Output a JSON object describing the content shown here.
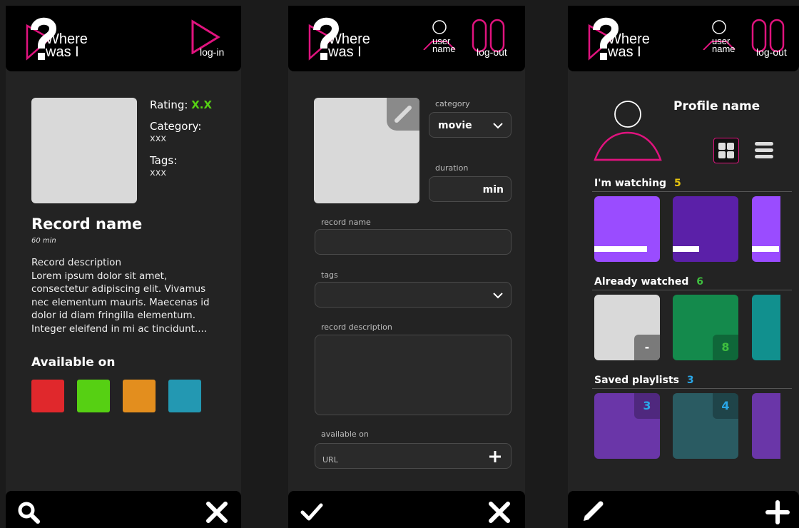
{
  "app": {
    "logo_line1": "Where",
    "logo_line2": "was I"
  },
  "screen1": {
    "header": {
      "login_label": "log-in"
    },
    "rating_label": "Rating:",
    "rating_value": "X.X",
    "category_label": "Category:",
    "category_value": "xxx",
    "tags_label": "Tags:",
    "tags_value": "xxx",
    "record_name": "Record name",
    "duration": "60 min",
    "description": "Record description\nLorem ipsum dolor sit amet, consectetur adipiscing elit. Vivamus nec elementum mauris. Maecenas id dolor id diam fringilla elementum. Integer eleifend in mi ac tincidunt....",
    "available_on": "Available on",
    "platform_colors": [
      "#e0282c",
      "#56d013",
      "#e38e1e",
      "#2398b2"
    ],
    "footer": {
      "search_icon": "search-icon",
      "close_icon": "close-icon"
    }
  },
  "screen2": {
    "header": {
      "user_name": "user name",
      "logout_label": "log-out"
    },
    "category_label": "category",
    "category_value": "movie",
    "duration_label": "duration",
    "duration_unit": "min",
    "record_name_label": "record name",
    "tags_label": "tags",
    "description_label": "record description",
    "available_on_label": "available on",
    "url_placeholder": "URL",
    "footer": {
      "confirm_icon": "check-icon",
      "close_icon": "close-icon"
    }
  },
  "screen3": {
    "header": {
      "user_name": "user name",
      "logout_label": "log-out"
    },
    "profile_name": "Profile name",
    "sections": [
      {
        "title": "I'm watching",
        "count": "5",
        "count_color": "#e8c60f"
      },
      {
        "title": "Already watched",
        "count": "6",
        "count_color": "#3fbf3f"
      },
      {
        "title": "Saved playlists",
        "count": "3",
        "count_color": "#2aa7e8"
      }
    ],
    "watching_progress": [
      0.8,
      0.4,
      0.95
    ],
    "watched_ratings": [
      "-",
      "8"
    ],
    "playlist_counts": [
      "3",
      "4"
    ],
    "footer": {
      "edit_icon": "pencil-icon",
      "add_icon": "plus-icon"
    }
  },
  "colors": {
    "accent": "#e0137e",
    "background": "#232323",
    "bar": "#000000"
  }
}
